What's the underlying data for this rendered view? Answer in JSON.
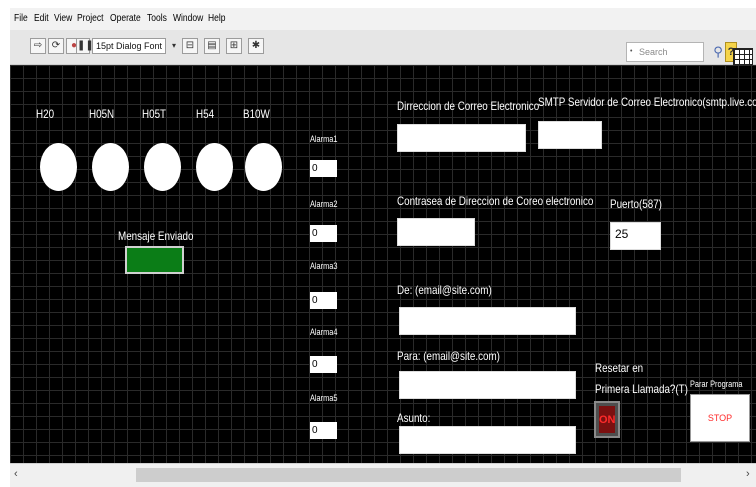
{
  "menu": [
    "File",
    "Edit",
    "View",
    "Project",
    "Operate",
    "Tools",
    "Window",
    "Help"
  ],
  "toolbar": {
    "font_label": "15pt Dialog Font",
    "search_placeholder": "Search",
    "tools": [
      "run-arrow-icon",
      "run-continuous-icon",
      "abort-icon",
      "pause-icon",
      "align-icon",
      "distribute-icon",
      "resize-icon",
      "reorder-icon"
    ]
  },
  "indicators": {
    "leds": [
      "H20",
      "H05N",
      "H05T",
      "H54",
      "B10W"
    ],
    "sent_label": "Mensaje Enviado",
    "sent_color": "#0b7d17"
  },
  "alarms": [
    {
      "label": "Alarma1",
      "value": "0"
    },
    {
      "label": "Alarma2",
      "value": "0"
    },
    {
      "label": "Alarma3",
      "value": "0"
    },
    {
      "label": "Alarma4",
      "value": "0"
    },
    {
      "label": "Alarma5",
      "value": "0"
    }
  ],
  "email": {
    "address_label": "Dirreccion de Correo Electronico",
    "smtp_label": "SMTP Servidor de Correo Electronico(smtp.live.com)",
    "password_label": "Contraseа de Direccion de Coreo electronico",
    "port_label": "Puerto(587)",
    "port_value": "25",
    "from_label": "De: (email@site.com)",
    "to_label": "Para: (email@site.com)",
    "subject_label": "Asunto:"
  },
  "controls": {
    "reset_label_1": "Resetar en",
    "reset_label_2": "Primera Llamada?(T)",
    "reset_state": "ON",
    "stop_label": "Parar Programa",
    "stop_button": "STOP"
  },
  "scrollbar": {
    "left": "‹",
    "right": "›"
  }
}
